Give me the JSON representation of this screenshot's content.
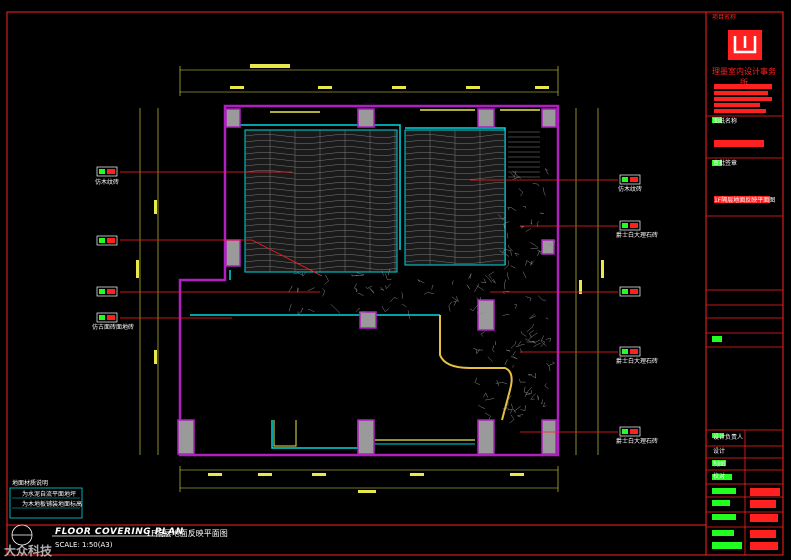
{
  "title_block": {
    "plan_title_en": "FLOOR COVERING PLAN",
    "plan_title_cn": "1F隔层地面反映平面图",
    "scale": "SCALE: 1:50(A3)",
    "firm_name": "理墨室内设计事务所",
    "project_label": "项目名称",
    "drawing_label": "图纸名称",
    "drawing_name": "1F隔层地面反映平面图",
    "approval_label": "审批签章",
    "designer_label": "设计负责人",
    "design_label": "设计",
    "draw_label": "制图",
    "check_label": "校对"
  },
  "legend": {
    "title": "地面材质说明",
    "items": [
      "为水泥自流平面地坪",
      "为木地板铺装地面标高"
    ]
  },
  "material_labels": {
    "left": [
      "仿木纹砖",
      "",
      "",
      "仿古面砖面地砖"
    ],
    "right": [
      "仿木纹砖",
      "爵士白大理石砖",
      "",
      "爵士白大理石砖",
      "爵士白大理石砖"
    ]
  },
  "watermark": "大众科技",
  "colors": {
    "wall": "#b020c0",
    "dimension": "#e8e84a",
    "cyan": "#00d8e0",
    "red": "#ff2020",
    "green": "#20ff20",
    "frame": "#ff2020"
  }
}
